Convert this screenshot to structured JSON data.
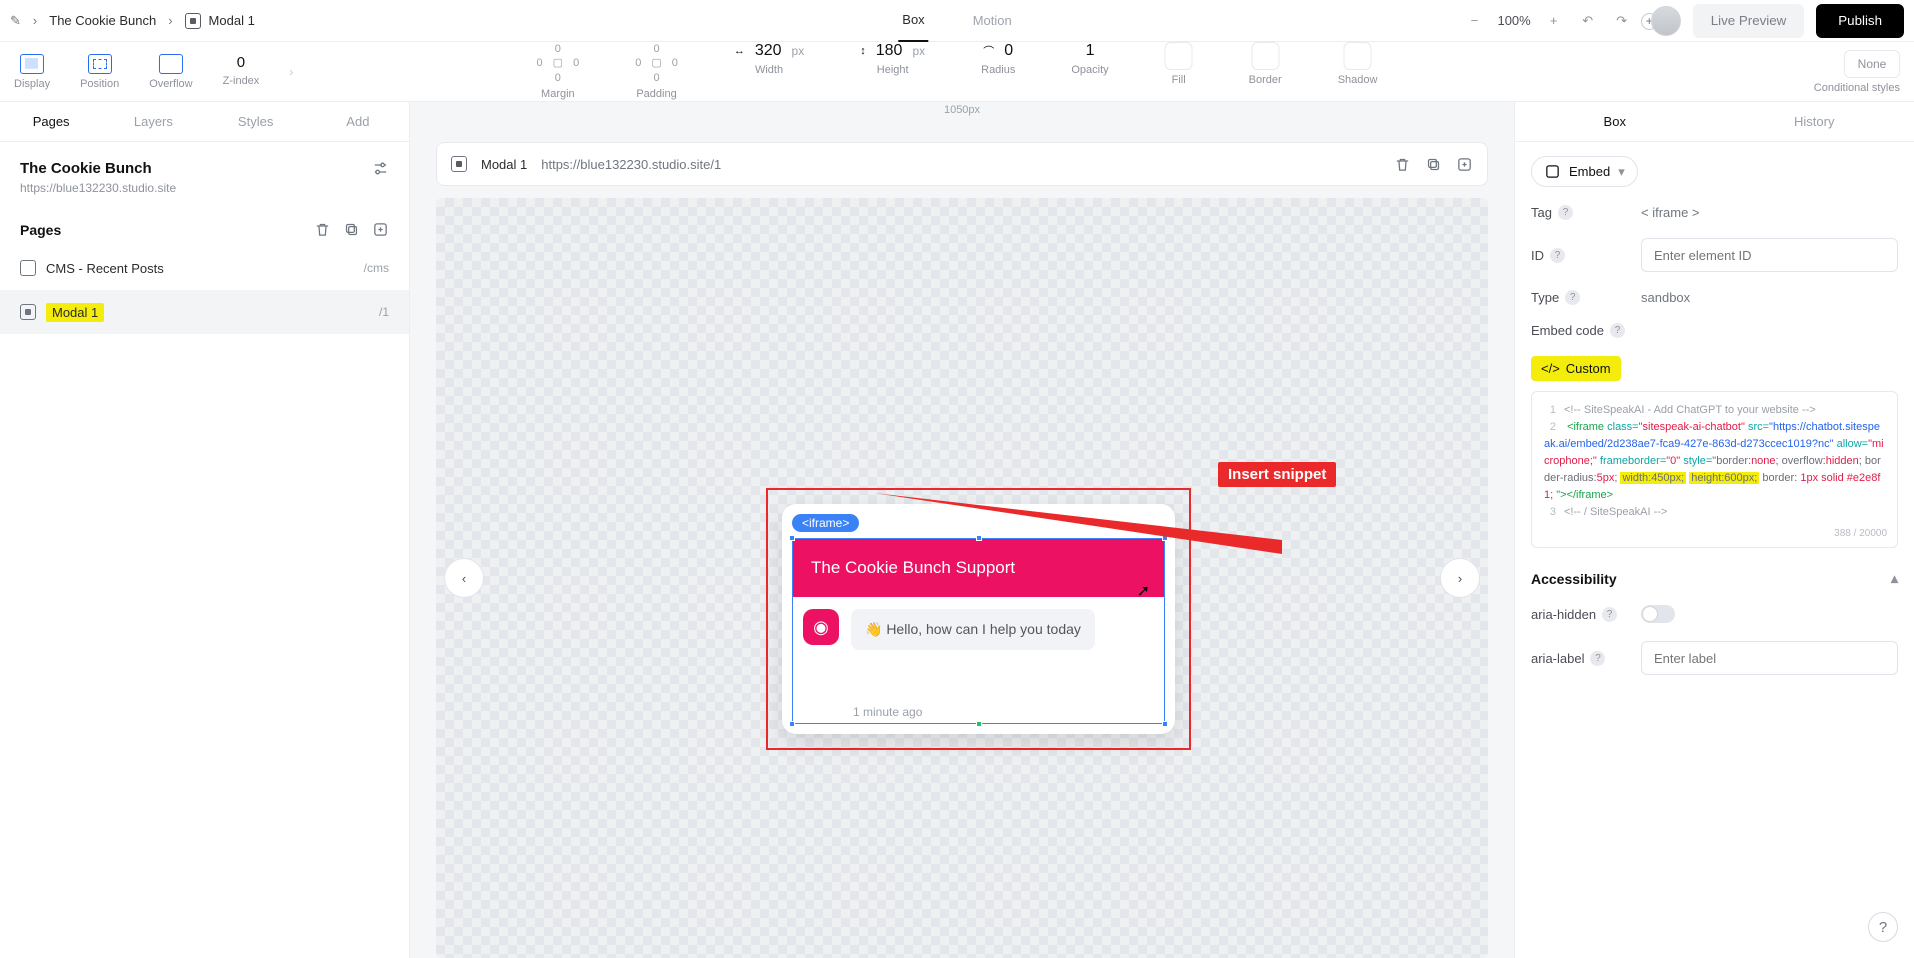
{
  "breadcrumb": {
    "project": "The Cookie Bunch",
    "page": "Modal 1"
  },
  "topTabs": {
    "box": "Box",
    "motion": "Motion"
  },
  "zoom": {
    "value": "100%"
  },
  "topButtons": {
    "live": "Live Preview",
    "publish": "Publish"
  },
  "props": {
    "display": "Display",
    "position": "Position",
    "overflow": "Overflow",
    "zindex_lbl": "Z-index",
    "zindex": "0",
    "margin_lbl": "Margin",
    "margin_t": "0",
    "margin_l": "0",
    "margin_r": "0",
    "margin_b": "0",
    "padding_lbl": "Padding",
    "padding_t": "0",
    "padding_l": "0",
    "padding_r": "0",
    "padding_b": "0",
    "width_lbl": "Width",
    "width": "320",
    "width_u": "px",
    "height_lbl": "Height",
    "height": "180",
    "height_u": "px",
    "radius_lbl": "Radius",
    "radius": "0",
    "opacity_lbl": "Opacity",
    "opacity": "1",
    "fill_lbl": "Fill",
    "border_lbl": "Border",
    "shadow_lbl": "Shadow",
    "cond_none": "None",
    "cond_lbl": "Conditional styles"
  },
  "leftTabs": {
    "pages": "Pages",
    "layers": "Layers",
    "styles": "Styles",
    "add": "Add"
  },
  "project": {
    "name": "The Cookie Bunch",
    "url": "https://blue132230.studio.site"
  },
  "pagesHeader": "Pages",
  "pages": [
    {
      "name": "CMS - Recent Posts",
      "slug": "/cms"
    },
    {
      "name": "Modal 1",
      "slug": "/1",
      "selected": true
    }
  ],
  "canvas": {
    "ruler": "1050px",
    "modalName": "Modal 1",
    "modalUrl": "https://blue132230.studio.site/1",
    "iframeTag": "<iframe>",
    "chatTitle": "The Cookie Bunch Support",
    "chatMsg": "👋 Hello, how can I help you today",
    "chatAgo": "1 minute ago",
    "callout": "Insert snippet"
  },
  "rightTabs": {
    "box": "Box",
    "history": "History"
  },
  "embed": {
    "chip": "Embed",
    "tag_k": "Tag",
    "tag_v": "< iframe >",
    "id_k": "ID",
    "id_ph": "Enter element ID",
    "type_k": "Type",
    "type_v": "sandbox",
    "code_k": "Embed code",
    "custom": "Custom",
    "counter": "388 / 20000"
  },
  "snippet": {
    "l1": "<!-- SiteSpeakAI - Add ChatGPT to your website -->",
    "tag_open": "<iframe",
    "cls_k": "class=",
    "cls_v": "\"sitespeak-ai-chatbot\"",
    "src_k": "src=",
    "src_v": "\"https://chatbot.sitespeak.ai/embed/2d238ae7-fca9-427e-863d-d273ccec1019?nc\"",
    "allow_k": "allow=",
    "allow_v": "\"microphone;\"",
    "fb_k": "frameborder=",
    "fb_v": "\"0\"",
    "style_k": "style=",
    "style_pre": "\"border:",
    "none": "none",
    "semi": "; ",
    "of_k": "overflow:",
    "of_v": "hidden",
    "br_k": "border-radius:",
    "br_v": "5px",
    "w": "width:450px;",
    "h": "height:600px;",
    "bd_k": "border: ",
    "bd_v": "1px solid #e2e8f1;",
    "close": "\"></iframe>",
    "l3": "<!-- / SiteSpeakAI -->"
  },
  "acc": {
    "title": "Accessibility",
    "hidden": "aria-hidden",
    "label": "aria-label",
    "label_ph": "Enter label"
  }
}
